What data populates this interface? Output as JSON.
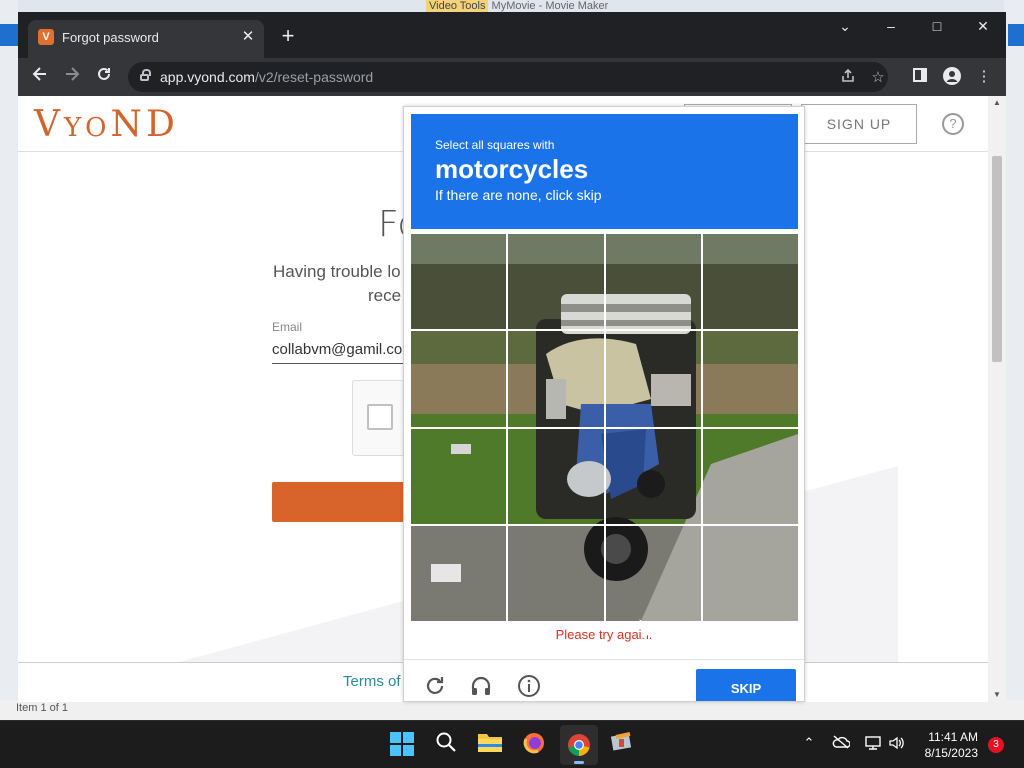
{
  "desktop": {
    "window_title_tag": "Video Tools",
    "window_title_rest": "MyMovie - Movie Maker",
    "status_text": "Item 1 of 1"
  },
  "browser": {
    "tab": {
      "favicon_letter": "V",
      "title": "Forgot password",
      "close": "✕"
    },
    "new_tab": "+",
    "window_controls": {
      "dropdown": "⌄",
      "minimize": "–",
      "maximize": "□",
      "close": "✕"
    },
    "url_host": "app.vyond.com",
    "url_path": "/v2/reset-password"
  },
  "page": {
    "logo_big_1": "V",
    "logo_small_1": "Y",
    "logo_small_2": "O",
    "logo_big_2": "N",
    "logo_big_3": "D",
    "signup_label": "SIGN UP",
    "help_label": "?",
    "heading": "Fo",
    "desc_line1": "Having trouble lo",
    "desc_line2": "rece",
    "email_label": "Email",
    "email_value": "collabvm@gamil.com",
    "footer_link": "Terms of"
  },
  "captcha": {
    "instruction_line1": "Select all squares with",
    "target": "motorcycles",
    "instruction_line3": "If there are none, click skip",
    "error": "Please try again.",
    "skip_label": "SKIP",
    "grid_size": 4
  },
  "taskbar": {
    "time": "11:41 AM",
    "date": "8/15/2023",
    "notification_count": "3"
  }
}
